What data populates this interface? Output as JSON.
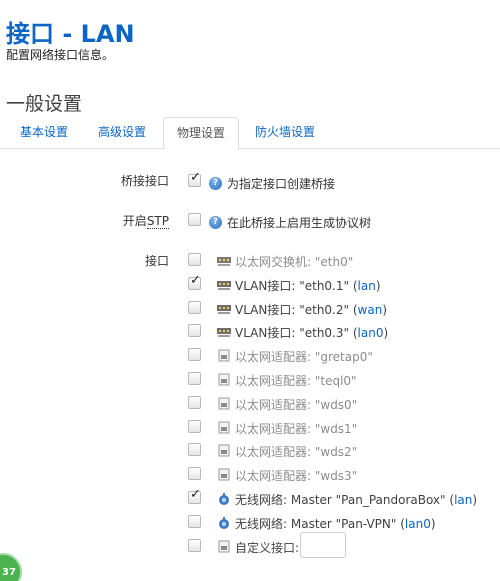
{
  "header": {
    "title": "接口 - LAN",
    "description": "配置网络接口信息。"
  },
  "section": {
    "title": "一般设置"
  },
  "tabs": [
    {
      "label": "基本设置",
      "active": false
    },
    {
      "label": "高级设置",
      "active": false
    },
    {
      "label": "物理设置",
      "active": true
    },
    {
      "label": "防火墙设置",
      "active": false
    }
  ],
  "bridge": {
    "label": "桥接接口",
    "checked": true,
    "help": "为指定接口创建桥接"
  },
  "stp": {
    "label_prefix": "开启",
    "label_abbr": "STP",
    "checked": false,
    "help": "在此桥接上启用生成协议树"
  },
  "interfaces": {
    "label": "接口",
    "items": [
      {
        "text": "以太网交换机: \"eth0\"",
        "network": "",
        "checked": false,
        "icon": "switch-icon",
        "dim": true
      },
      {
        "text": "VLAN接口: \"eth0.1\" (",
        "network": "lan",
        "suffix": ")",
        "checked": true,
        "icon": "vlan-icon",
        "dim": false
      },
      {
        "text": "VLAN接口: \"eth0.2\" (",
        "network": "wan",
        "suffix": ")",
        "checked": false,
        "icon": "vlan-icon",
        "dim": false
      },
      {
        "text": "VLAN接口: \"eth0.3\" (",
        "network": "lan0",
        "suffix": ")",
        "checked": false,
        "icon": "vlan-icon",
        "dim": false
      },
      {
        "text": "以太网适配器: \"gretap0\"",
        "network": "",
        "checked": false,
        "icon": "ethernet-adapter-icon",
        "dim": true
      },
      {
        "text": "以太网适配器: \"teql0\"",
        "network": "",
        "checked": false,
        "icon": "ethernet-adapter-icon",
        "dim": true
      },
      {
        "text": "以太网适配器: \"wds0\"",
        "network": "",
        "checked": false,
        "icon": "ethernet-adapter-icon",
        "dim": true
      },
      {
        "text": "以太网适配器: \"wds1\"",
        "network": "",
        "checked": false,
        "icon": "ethernet-adapter-icon",
        "dim": true
      },
      {
        "text": "以太网适配器: \"wds2\"",
        "network": "",
        "checked": false,
        "icon": "ethernet-adapter-icon",
        "dim": true
      },
      {
        "text": "以太网适配器: \"wds3\"",
        "network": "",
        "checked": false,
        "icon": "ethernet-adapter-icon",
        "dim": true
      },
      {
        "text": "无线网络: Master \"Pan_PandoraBox\" (",
        "network": "lan",
        "suffix": ")",
        "checked": true,
        "icon": "wireless-icon",
        "dim": false
      },
      {
        "text": "无线网络: Master \"Pan-VPN\" (",
        "network": "lan0",
        "suffix": ")",
        "checked": false,
        "icon": "wireless-icon",
        "dim": false
      },
      {
        "text": "自定义接口:",
        "network": "",
        "checked": false,
        "icon": "custom-interface-icon",
        "dim": false
      }
    ],
    "custom_value": ""
  },
  "badge": {
    "text": "37"
  },
  "colors": {
    "accent": "#0b65c4",
    "badge": "#4ab34f"
  }
}
